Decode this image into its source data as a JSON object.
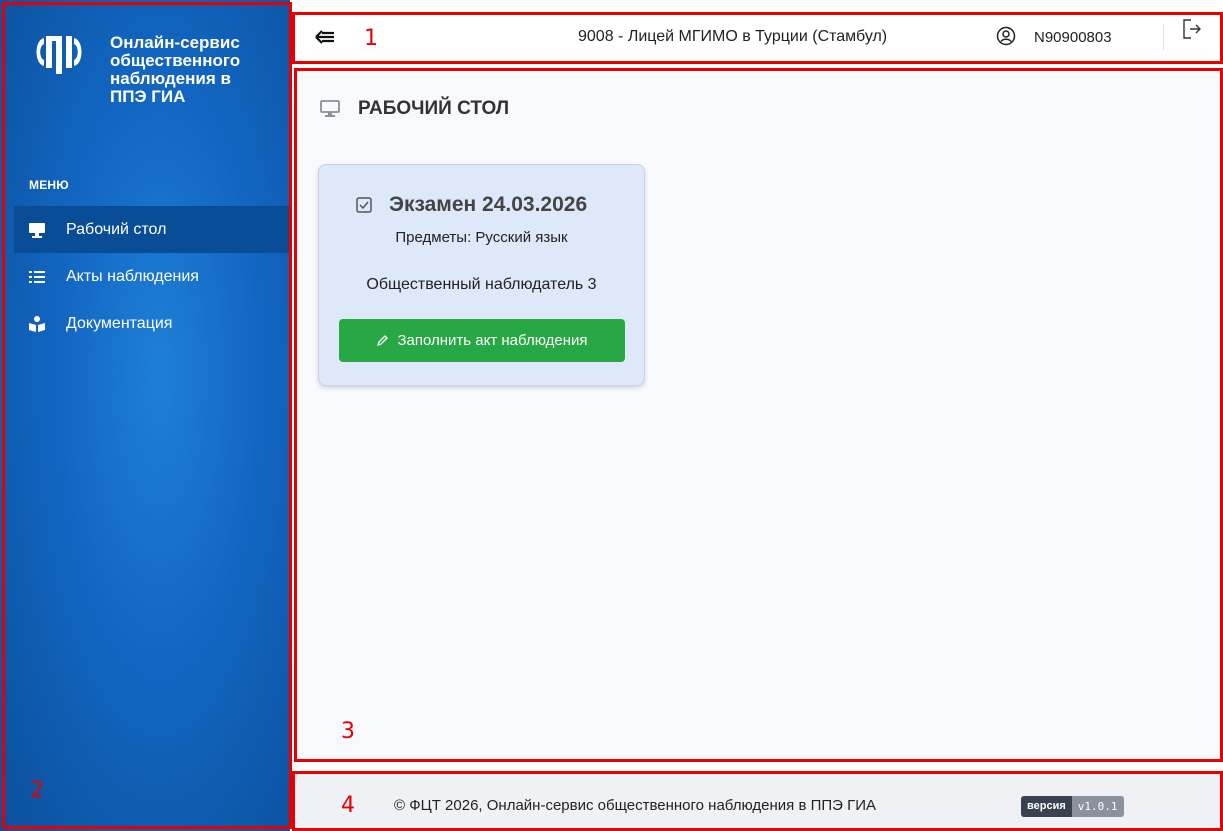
{
  "sidebar": {
    "brand_line1": "Онлайн-сервис",
    "brand_line2": "общественного",
    "brand_line3": "наблюдения в",
    "brand_line4": "ППЭ ГИА",
    "logo_icon": "ftsc-logo-icon",
    "menu_title": "МЕНЮ",
    "items": [
      {
        "label": "Рабочий стол",
        "icon": "monitor-icon",
        "active": true
      },
      {
        "label": "Акты наблюдения",
        "icon": "list-icon",
        "active": false
      },
      {
        "label": "Документация",
        "icon": "reading-icon",
        "active": false
      }
    ],
    "colors": {
      "background": "#1266c1",
      "active_item": "#0a4d97"
    }
  },
  "header": {
    "school": "9008 - Лицей МГИМО в Турции (Стамбул)",
    "user_login": "N90900803",
    "icons": [
      "sidebar-toggle-icon",
      "user-circle-icon",
      "logout-icon"
    ]
  },
  "main": {
    "title": "РАБОЧИЙ СТОЛ",
    "title_icon": "monitor-icon",
    "exam_card": {
      "title": "Экзамен 24.03.2026",
      "subjects": "Предметы: Русский язык",
      "role": "Общественный наблюдатель 3",
      "button_label": "Заполнить акт наблюдения",
      "title_icon": "checkbox-icon",
      "button_icon": "pencil-icon",
      "colors": {
        "card_background": "#dde8f8",
        "button": "#27a844"
      }
    }
  },
  "footer": {
    "text": "© ФЦТ 2026, Онлайн-сервис общественного наблюдения в ППЭ ГИА",
    "version_label": "версия",
    "version_value": "v1.0.1"
  },
  "annotations": {
    "color": "#e60000",
    "labels": [
      "1",
      "2",
      "3",
      "4"
    ]
  }
}
